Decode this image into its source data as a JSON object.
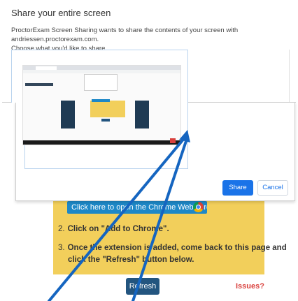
{
  "dialog": {
    "title": "Share your entire screen",
    "description_line1": "ProctorExam Screen Sharing wants to share the contents of your screen with andriessen.proctorexam.com.",
    "description_line2": "Choose what you'd like to share.",
    "share_label": "Share",
    "cancel_label": "Cancel"
  },
  "background_page": {
    "step1_button": "Click here to open the Chrome Webstore.",
    "step2_number": "2.",
    "step2_text": "Click on \"Add to Chrome\".",
    "step3_number": "3.",
    "step3_line1": "Once the extension is added, come back to this page and",
    "step3_line2": "click the \"Refresh\" button below.",
    "refresh_label": "Refresh",
    "issues_label": "Issues?"
  },
  "colors": {
    "accent_blue": "#1a73e8",
    "panel_yellow": "#f2cf5b",
    "refresh_navy": "#23557f",
    "issues_red": "#d9413d",
    "arrow_blue": "#1565c0"
  }
}
